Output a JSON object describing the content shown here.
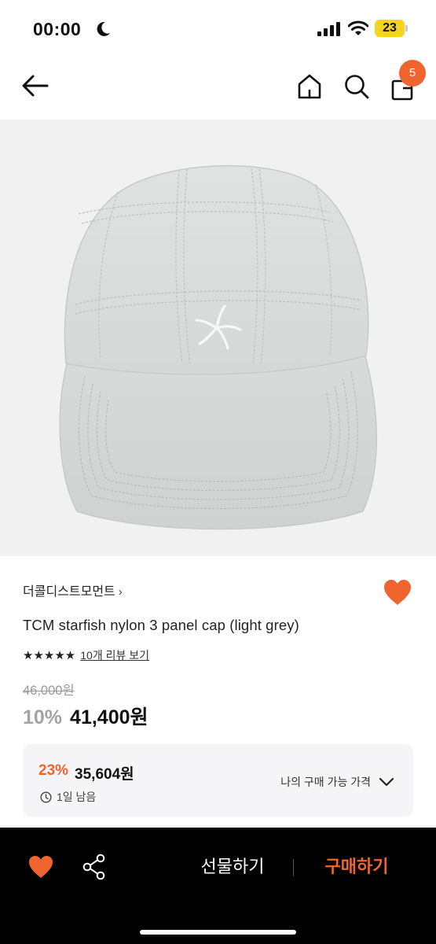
{
  "status_bar": {
    "time": "00:00",
    "battery": "23"
  },
  "nav": {
    "cart_count": "5"
  },
  "product": {
    "brand": "더콜디스트모먼트",
    "brand_chevron": "›",
    "title": "TCM starfish nylon 3 panel cap (light grey)",
    "rating": 4.5,
    "stars": "★★★★★",
    "review_link": "10개 리뷰 보기",
    "original_price": "46,000원",
    "discount_rate": "10%",
    "sale_price": "41,400원"
  },
  "coupon": {
    "rate": "23%",
    "price": "35,604원",
    "time_left": "1일 남음",
    "action_label": "나의 구매 가능 가격"
  },
  "bottom_bar": {
    "gift_label": "선물하기",
    "buy_label": "구매하기"
  },
  "colors": {
    "accent": "#f0652f",
    "bottom_bar_bg": "#000000",
    "image_bg": "#f1f1f1",
    "coupon_bg": "#f5f5f7"
  }
}
